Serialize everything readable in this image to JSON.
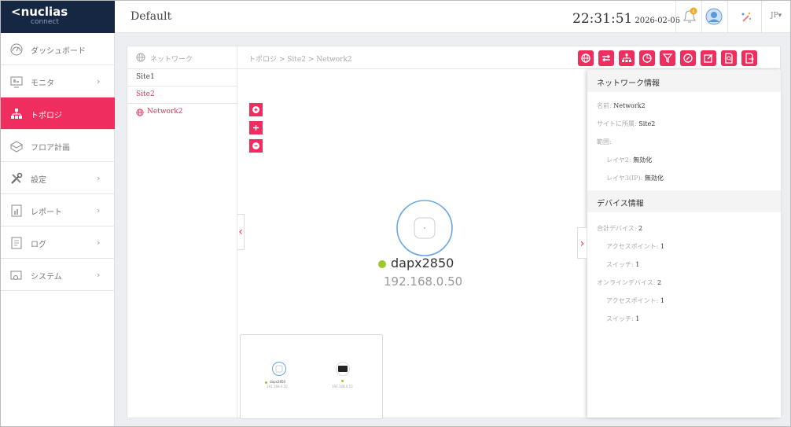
{
  "app": {
    "brand": "nuclias",
    "brand_sub": "connect",
    "page_title": "Default"
  },
  "header": {
    "time": "22:31:51",
    "date": "2026-02-06",
    "lang": "JP"
  },
  "sidebar": {
    "items": [
      {
        "label": "ダッシュボード",
        "icon": "dashboard-icon",
        "has_arrow": false,
        "active": false
      },
      {
        "label": "モニタ",
        "icon": "monitor-icon",
        "has_arrow": true,
        "active": false
      },
      {
        "label": "トポロジ",
        "icon": "topology-icon",
        "has_arrow": false,
        "active": true
      },
      {
        "label": "フロア計画",
        "icon": "floor-plan-icon",
        "has_arrow": false,
        "active": false
      },
      {
        "label": "設定",
        "icon": "settings-icon",
        "has_arrow": true,
        "active": false
      },
      {
        "label": "レポート",
        "icon": "report-icon",
        "has_arrow": true,
        "active": false
      },
      {
        "label": "ログ",
        "icon": "log-icon",
        "has_arrow": true,
        "active": false
      },
      {
        "label": "システム",
        "icon": "system-icon",
        "has_arrow": true,
        "active": false
      }
    ]
  },
  "tree": {
    "header": "ネットワーク",
    "items": [
      "Site1",
      "Site2",
      "Network2"
    ]
  },
  "breadcrumb": "トポロジ > Site2 > Network2",
  "canvas": {
    "device_name": "dapx2850",
    "device_ip": "192.168.0.50",
    "status_color": "#9dc72b"
  },
  "minimap": {
    "device1_name": "dapx2850",
    "device1_ip": "192.168.0.50",
    "device2_ip": "192.168.0.53"
  },
  "info": {
    "network_title": "ネットワーク情報",
    "name_label": "名前:",
    "name_value": "Network2",
    "site_label": "サイトに所属:",
    "site_value": "Site2",
    "scope_label": "範囲:",
    "layer2_label": "レイヤ2:",
    "layer2_value": "無効化",
    "layer3_label": "レイヤ3(IP):",
    "layer3_value": "無効化",
    "device_title": "デバイス情報",
    "total_label": "合計デバイス:",
    "total_value": "2",
    "ap_label": "アクセスポイント:",
    "ap_value": "1",
    "switch_label": "スイッチ:",
    "switch_value": "1",
    "online_label": "オンラインデバイス:",
    "online_value": "2",
    "online_ap_label": "アクセスポイント:",
    "online_ap_value": "1",
    "online_switch_label": "スイッチ:",
    "online_switch_value": "1"
  },
  "colors": {
    "accent": "#ef2d5e",
    "sidebar_brand": "#152743",
    "online": "#9dc72b"
  }
}
